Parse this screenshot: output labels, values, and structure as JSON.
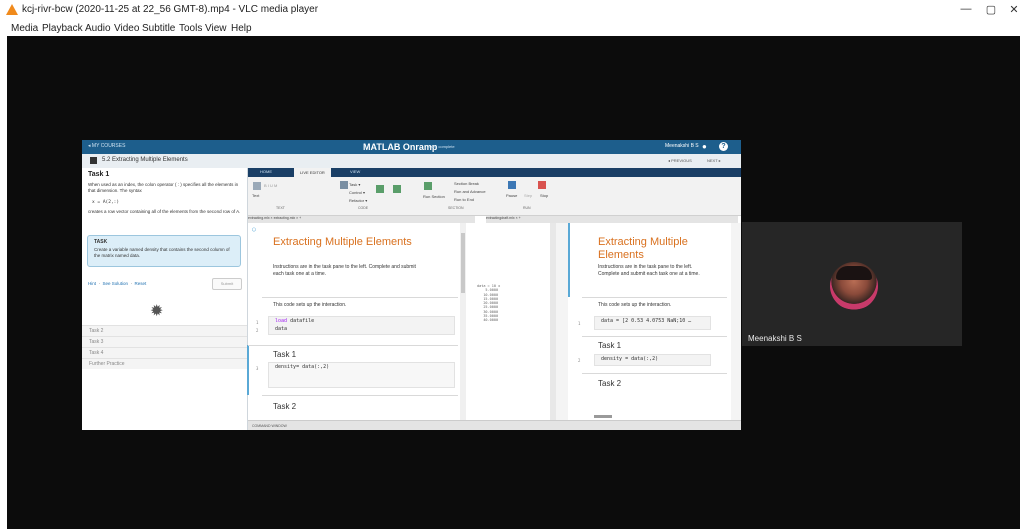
{
  "window": {
    "title": "kcj-rivr-bcw (2020-11-25 at 22_56 GMT-8).mp4 - VLC media player",
    "controls": {
      "minimize": "—",
      "maximize": "▢",
      "close": "✕"
    }
  },
  "menu": [
    "Media",
    "Playback",
    "Audio",
    "Video",
    "Subtitle",
    "Tools",
    "View",
    "Help"
  ],
  "onramp": {
    "back_link": "◂ MY COURSES",
    "brand": "MATLAB Onramp",
    "brand_sub": "100% complete",
    "user": "Meenakshi B S",
    "lesson_title": "5.2 Extracting Multiple Elements",
    "previous": "◂ PREVIOUS",
    "next": "NEXT ▸",
    "task_heading": "Task 1",
    "task_desc_1": "When used as an index, the colon operator ( : ) specifies all the elements in that dimension. The syntax",
    "task_code": "x = A(2,:)",
    "task_desc_2": "creates a row vector containing all of the elements from the second row of A.",
    "task_box_label": "TASK",
    "task_box_text": "Create a variable named density that contains the second column of the matrix named data.",
    "hint": "Hint",
    "see_solution": "See Solution",
    "reset": "Reset",
    "submit": "Submit",
    "tasks": [
      "Task 2",
      "Task 3",
      "Task 4",
      "Further Practice"
    ]
  },
  "ribbon": {
    "tabs": [
      "HOME",
      "LIVE EDITOR",
      "VIEW"
    ],
    "groups": [
      "TEXT",
      "CODE",
      "SECTION",
      "RUN"
    ],
    "buttons": {
      "text": "Text",
      "task": "Task ▾",
      "control": "Control ▾",
      "refactor": "Refactor ▾",
      "run_section": "Run Section",
      "section_break": "Section Break",
      "run_and_advance": "Run and Advance",
      "run_to_end": "Run to End",
      "pause": "Pause",
      "step": "Step",
      "stop": "Stop"
    }
  },
  "editor_left": {
    "tabs": "extracting.mlx ×  extracting.mlx ×  +",
    "title": "Extracting Multiple Elements",
    "intro": "Instructions are in the task pane to the left. Complete and submit each task one at a time.",
    "setup_text": "This code sets up the interaction.",
    "setup_line_1_kw": "load",
    "setup_line_1_arg": "datafile",
    "setup_line_2": "data",
    "task1_heading": "Task 1",
    "task1_code": "density= data(:,2)",
    "task2_heading": "Task 2",
    "line_numbers": [
      "1",
      "2",
      "3"
    ],
    "output_lines": "data = 10 x\n    5.0000\n   10.0000\n   15.0000\n   20.0000\n   25.0000\n   30.0000\n   35.0000\n   40.0000"
  },
  "editor_right": {
    "tabs": "extractingdraft.mlx ×  +",
    "title": "Extracting Multiple Elements",
    "intro": "Instructions are in the task pane to the left. Complete and submit each task one at a time.",
    "setup_text": "This code sets up the interaction.",
    "setup_code": "data = [2 0.53 4.0753 NaN;10 …",
    "task1_heading": "Task 1",
    "task1_code": "density = data(:,2)",
    "task2_heading": "Task 2",
    "line_numbers": [
      "1",
      "2"
    ]
  },
  "command_window": "COMMAND WINDOW",
  "participant": {
    "name": "Meenakshi B S"
  }
}
